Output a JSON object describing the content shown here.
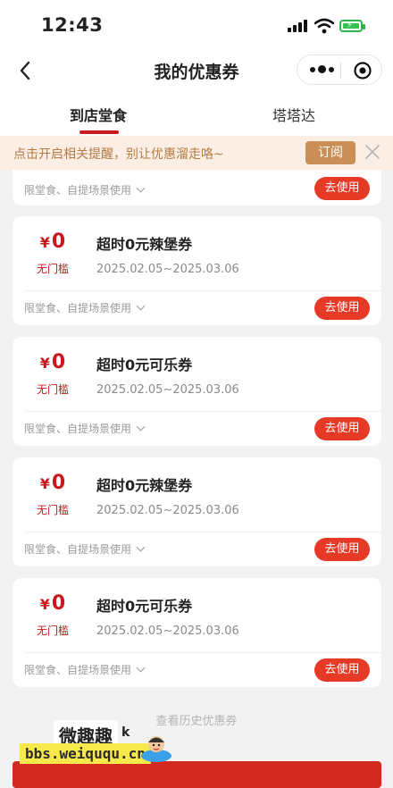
{
  "status_bar": {
    "time": "12:43"
  },
  "nav": {
    "title": "我的优惠券"
  },
  "tabs": [
    {
      "label": "到店堂食",
      "active": true
    },
    {
      "label": "塔塔达",
      "active": false
    }
  ],
  "notice": {
    "text": "点击开启相关提醒，别让优惠溜走咯~",
    "button": "订阅"
  },
  "partial_card": {
    "scope": "限堂食、自提场景使用",
    "button": "去使用"
  },
  "coupons": [
    {
      "currency": "¥",
      "amount": "0",
      "threshold": "无门槛",
      "title": "超时0元辣堡券",
      "date": "2025.02.05~2025.03.06",
      "scope": "限堂食、自提场景使用",
      "button": "去使用"
    },
    {
      "currency": "¥",
      "amount": "0",
      "threshold": "无门槛",
      "title": "超时0元可乐券",
      "date": "2025.02.05~2025.03.06",
      "scope": "限堂食、自提场景使用",
      "button": "去使用"
    },
    {
      "currency": "¥",
      "amount": "0",
      "threshold": "无门槛",
      "title": "超时0元辣堡券",
      "date": "2025.02.05~2025.03.06",
      "scope": "限堂食、自提场景使用",
      "button": "去使用"
    },
    {
      "currency": "¥",
      "amount": "0",
      "threshold": "无门槛",
      "title": "超时0元可乐券",
      "date": "2025.02.05~2025.03.06",
      "scope": "限堂食、自提场景使用",
      "button": "去使用"
    }
  ],
  "history_link": "查看历史优惠券",
  "watermark": {
    "sticker": "微趣趣",
    "url": "bbs.weiququ.cn",
    "mark": "k"
  },
  "colors": {
    "brand_red": "#c8191e",
    "button_red": "#e63a27",
    "notice_bg": "#fbeee4",
    "notice_button": "#c98f57"
  }
}
